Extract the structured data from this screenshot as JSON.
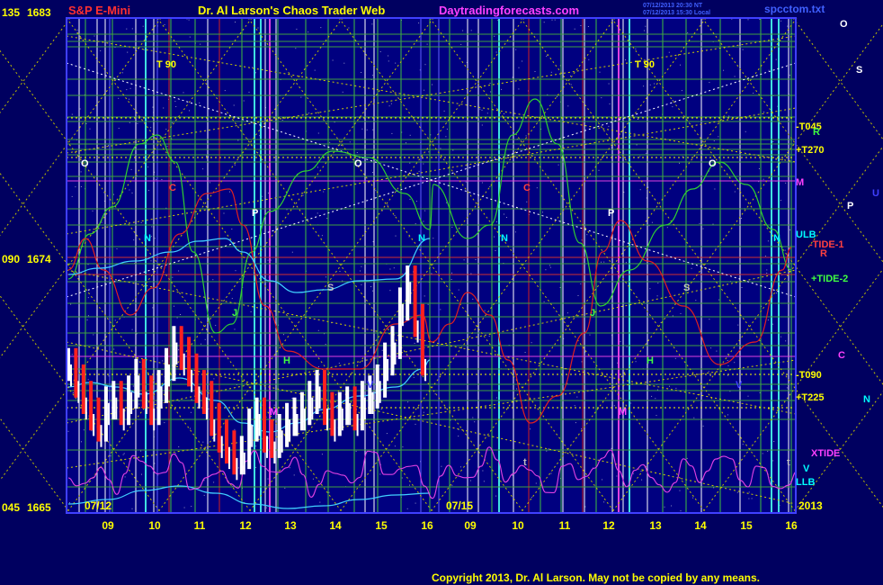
{
  "chart_data": {
    "type": "line",
    "header": {
      "instrument": "S&P E-Mini",
      "publisher": "Dr. Al Larson's Chaos Trader Web",
      "website": "Daytradingforecasts.com",
      "timestamp1": "07/12/2013 20:30 NT",
      "timestamp2": "07/12/2013 15:30 Local",
      "filename": "spcctom.txt"
    },
    "y_axis_labels": [
      {
        "angle": "135",
        "price": "1683"
      },
      {
        "angle": "090",
        "price": "1674"
      },
      {
        "angle": "045",
        "price": "1665"
      }
    ],
    "ylim": [
      1665,
      1683
    ],
    "x_tick_labels": [
      "09",
      "10",
      "11",
      "12",
      "13",
      "14",
      "15",
      "16",
      "09",
      "10",
      "11",
      "12",
      "13",
      "14",
      "15",
      "16"
    ],
    "date_labels": [
      "07/12",
      "07/15"
    ],
    "year_label": "2013",
    "right_level_labels": [
      {
        "text": "-T045",
        "color": "#ffff00"
      },
      {
        "text": "+T270",
        "color": "#ffff00"
      },
      {
        "text": "M",
        "color": "#ff40ff"
      },
      {
        "text": "ULB",
        "color": "#00ffff"
      },
      {
        "text": "-TIDE-1",
        "color": "#ff4040"
      },
      {
        "text": "+TIDE-2",
        "color": "#40ff40"
      },
      {
        "text": "-T090",
        "color": "#ffff00"
      },
      {
        "text": "+T225",
        "color": "#ffff00"
      },
      {
        "text": "XTIDE",
        "color": "#ff40ff"
      },
      {
        "text": "LLB",
        "color": "#00ffff"
      }
    ],
    "planet_column": [
      {
        "text": "O",
        "color": "#ffffff"
      },
      {
        "text": "S",
        "color": "#ffffff"
      },
      {
        "text": "U",
        "color": "#4040ff"
      },
      {
        "text": "P",
        "color": "#ffffff"
      },
      {
        "text": "C",
        "color": "#ff40ff"
      },
      {
        "text": "N",
        "color": "#00ffff"
      },
      {
        "text": "V",
        "color": "#00ffff"
      }
    ],
    "chart_markers": [
      {
        "text": "T 90",
        "color": "#ffff00"
      },
      {
        "text": "T 90",
        "color": "#ffff00"
      },
      {
        "text": "O",
        "color": "#ffffff"
      },
      {
        "text": "O",
        "color": "#ffffff"
      },
      {
        "text": "O",
        "color": "#ffffff"
      },
      {
        "text": "C",
        "color": "#ff4040"
      },
      {
        "text": "C",
        "color": "#ff4040"
      },
      {
        "text": "N",
        "color": "#00ffff"
      },
      {
        "text": "N",
        "color": "#00ffff"
      },
      {
        "text": "N",
        "color": "#00ffff"
      },
      {
        "text": "N",
        "color": "#00ffff"
      },
      {
        "text": "P",
        "color": "#ffffff"
      },
      {
        "text": "P",
        "color": "#ffffff"
      },
      {
        "text": "S",
        "color": "#c0c0c0"
      },
      {
        "text": "S",
        "color": "#c0c0c0"
      },
      {
        "text": "J",
        "color": "#40ff40"
      },
      {
        "text": "J",
        "color": "#40ff40"
      },
      {
        "text": "H",
        "color": "#40ff40"
      },
      {
        "text": "H",
        "color": "#40ff40"
      },
      {
        "text": "M",
        "color": "#ff40ff"
      },
      {
        "text": "M",
        "color": "#ff40ff"
      },
      {
        "text": "V",
        "color": "#4040ff"
      },
      {
        "text": "V",
        "color": "#4040ff"
      },
      {
        "text": "t",
        "color": "#c0c0c0"
      },
      {
        "text": "t",
        "color": "#c0c0c0"
      },
      {
        "text": "R",
        "color": "#40ff40"
      },
      {
        "text": "R",
        "color": "#ff4040"
      }
    ],
    "price_series": [
      1670.4,
      1669.8,
      1669.2,
      1668.6,
      1668.2,
      1669.0,
      1669.2,
      1668.8,
      1669.4,
      1670.0,
      1669.4,
      1668.8,
      1669.6,
      1670.4,
      1671.2,
      1670.8,
      1670.2,
      1669.6,
      1669.2,
      1668.4,
      1667.8,
      1667.4,
      1667.0,
      1667.2,
      1668.2,
      1668.6,
      1667.8,
      1667.6,
      1668.0,
      1668.4,
      1668.6,
      1668.8,
      1669.2,
      1669.6,
      1668.8,
      1668.4,
      1668.8,
      1669.0,
      1668.6,
      1669.2,
      1669.4,
      1669.8,
      1670.6,
      1671.2,
      1672.6,
      1673.4,
      1672.0,
      1670.6
    ],
    "copyright": "Copyright 2013, Dr. Al Larson. May not be copied by any means."
  }
}
